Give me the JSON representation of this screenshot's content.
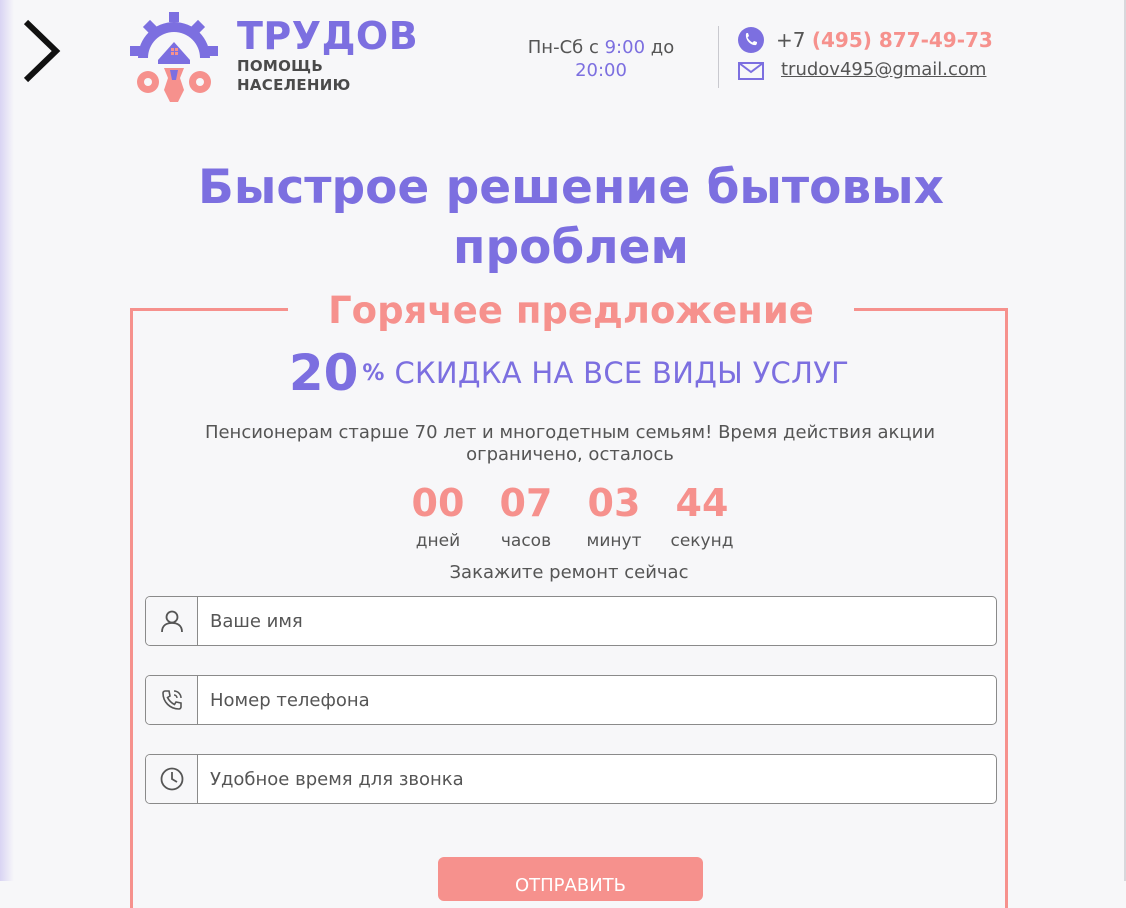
{
  "header": {
    "brand_title": "ТРУДОВ",
    "brand_sub_line1": "ПОМОЩЬ",
    "brand_sub_line2": "НАСЕЛЕНИЮ",
    "hours_prefix": "Пн-Сб с",
    "hours_from": "9:00",
    "hours_mid": "до",
    "hours_to": "20:00",
    "phone_prefix": "+7",
    "phone_number": "(495) 877-49-73",
    "email": "trudov495@gmail.com"
  },
  "hero": {
    "title": "Быстрое решение бытовых проблем"
  },
  "offer": {
    "title": "Горячее предложение",
    "discount_value": "20",
    "discount_unit": "%",
    "discount_text": "СКИДКА НА ВСЕ ВИДЫ УСЛУГ",
    "description": "Пенсионерам старше 70 лет и многодетным семьям! Время действия акции ограничено, осталось",
    "timer": [
      {
        "value": "00",
        "unit": "дней"
      },
      {
        "value": "07",
        "unit": "часов"
      },
      {
        "value": "03",
        "unit": "минут"
      },
      {
        "value": "44",
        "unit": "секунд"
      }
    ],
    "order_call": "Закажите ремонт сейчас"
  },
  "form": {
    "name_placeholder": "Ваше имя",
    "phone_placeholder": "Номер телефона",
    "time_placeholder": "Удобное время для звонка",
    "submit_label": "ОТПРАВИТЬ"
  },
  "colors": {
    "accent": "#7c6fe0",
    "coral": "#f6918d",
    "background": "#f7f7f9"
  }
}
